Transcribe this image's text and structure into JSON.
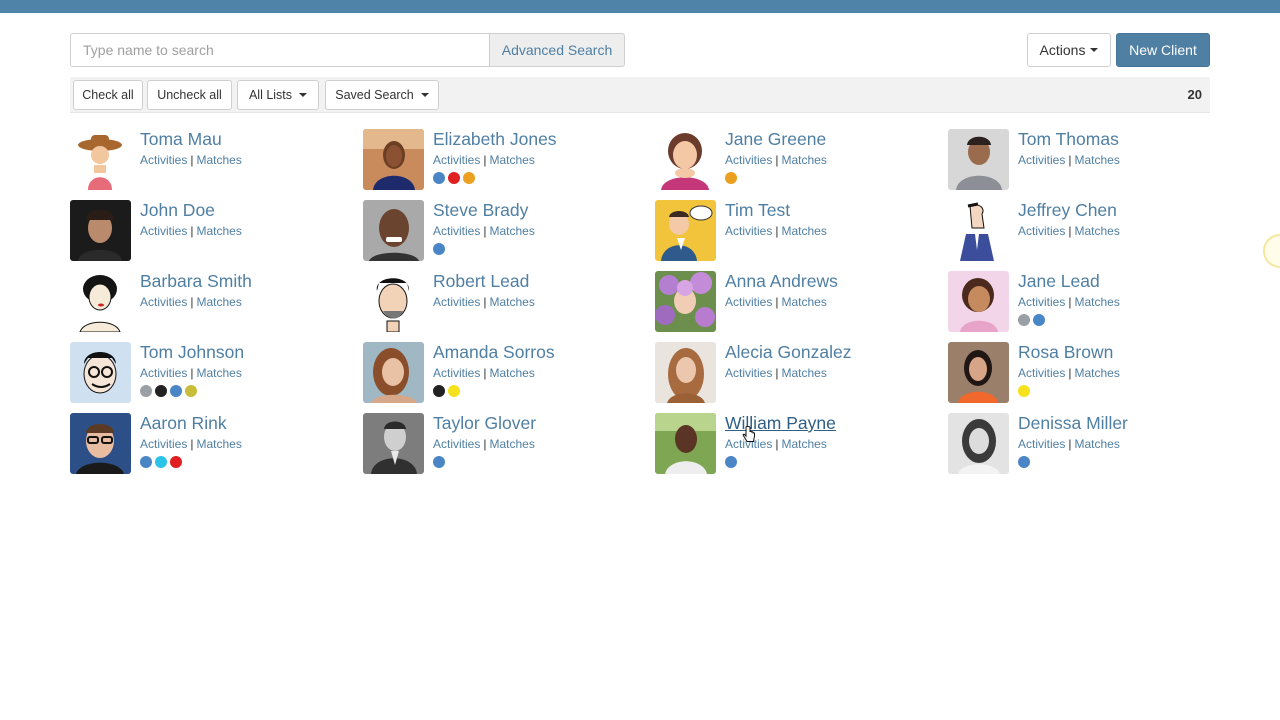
{
  "search": {
    "placeholder": "Type name to search",
    "advanced_label": "Advanced Search"
  },
  "header": {
    "actions_label": "Actions",
    "new_client_label": "New Client"
  },
  "toolbar": {
    "check_all": "Check all",
    "uncheck_all": "Uncheck all",
    "all_lists": "All Lists",
    "saved_search": "Saved Search",
    "count": "20"
  },
  "link_labels": {
    "activities": "Activities",
    "separator": "|",
    "matches": "Matches"
  },
  "tag_colors": {
    "blue": "#4a86c5",
    "red": "#e02020",
    "orange": "#eba020",
    "gray": "#9aa0a6",
    "black": "#222222",
    "olive": "#c8bd3a",
    "yellow": "#f5e21c",
    "cyan": "#2bc4e8"
  },
  "clients": [
    {
      "name": "Toma Mau",
      "tags": [],
      "avatar": "cartoon-cowgirl"
    },
    {
      "name": "Elizabeth Jones",
      "tags": [
        "blue",
        "red",
        "orange"
      ],
      "avatar": "photo-woman"
    },
    {
      "name": "Jane Greene",
      "tags": [
        "orange"
      ],
      "avatar": "cartoon-woman"
    },
    {
      "name": "Tom Thomas",
      "tags": [],
      "avatar": "photo-man"
    },
    {
      "name": "John Doe",
      "tags": [],
      "avatar": "photo-man-dark"
    },
    {
      "name": "Steve Brady",
      "tags": [
        "blue"
      ],
      "avatar": "photo-man-smiling"
    },
    {
      "name": "Tim Test",
      "tags": [],
      "avatar": "cartoon-businessman"
    },
    {
      "name": "Jeffrey Chen",
      "tags": [],
      "avatar": "cartoon-man-suit"
    },
    {
      "name": "Barbara Smith",
      "tags": [],
      "avatar": "cartoon-woman-bw"
    },
    {
      "name": "Robert Lead",
      "tags": [],
      "avatar": "cartoon-man-bw"
    },
    {
      "name": "Anna Andrews",
      "tags": [],
      "avatar": "photo-flowers"
    },
    {
      "name": "Jane Lead",
      "tags": [
        "gray",
        "blue"
      ],
      "avatar": "cartoon-woman-pink"
    },
    {
      "name": "Tom Johnson",
      "tags": [
        "gray",
        "black",
        "blue",
        "olive"
      ],
      "avatar": "cartoon-man-glasses"
    },
    {
      "name": "Amanda Sorros",
      "tags": [
        "black",
        "yellow"
      ],
      "avatar": "photo-woman-brunette"
    },
    {
      "name": "Alecia Gonzalez",
      "tags": [],
      "avatar": "photo-woman-long-hair"
    },
    {
      "name": "Rosa Brown",
      "tags": [
        "yellow"
      ],
      "avatar": "photo-woman-orange"
    },
    {
      "name": "Aaron Rink",
      "tags": [
        "blue",
        "cyan",
        "red"
      ],
      "avatar": "photo-man-glasses"
    },
    {
      "name": "Taylor Glover",
      "tags": [
        "blue"
      ],
      "avatar": "photo-man-bw"
    },
    {
      "name": "William Payne",
      "tags": [
        "blue"
      ],
      "avatar": "photo-man-outdoor"
    },
    {
      "name": "Denissa Miller",
      "tags": [
        "blue"
      ],
      "avatar": "photo-woman-bw"
    }
  ]
}
